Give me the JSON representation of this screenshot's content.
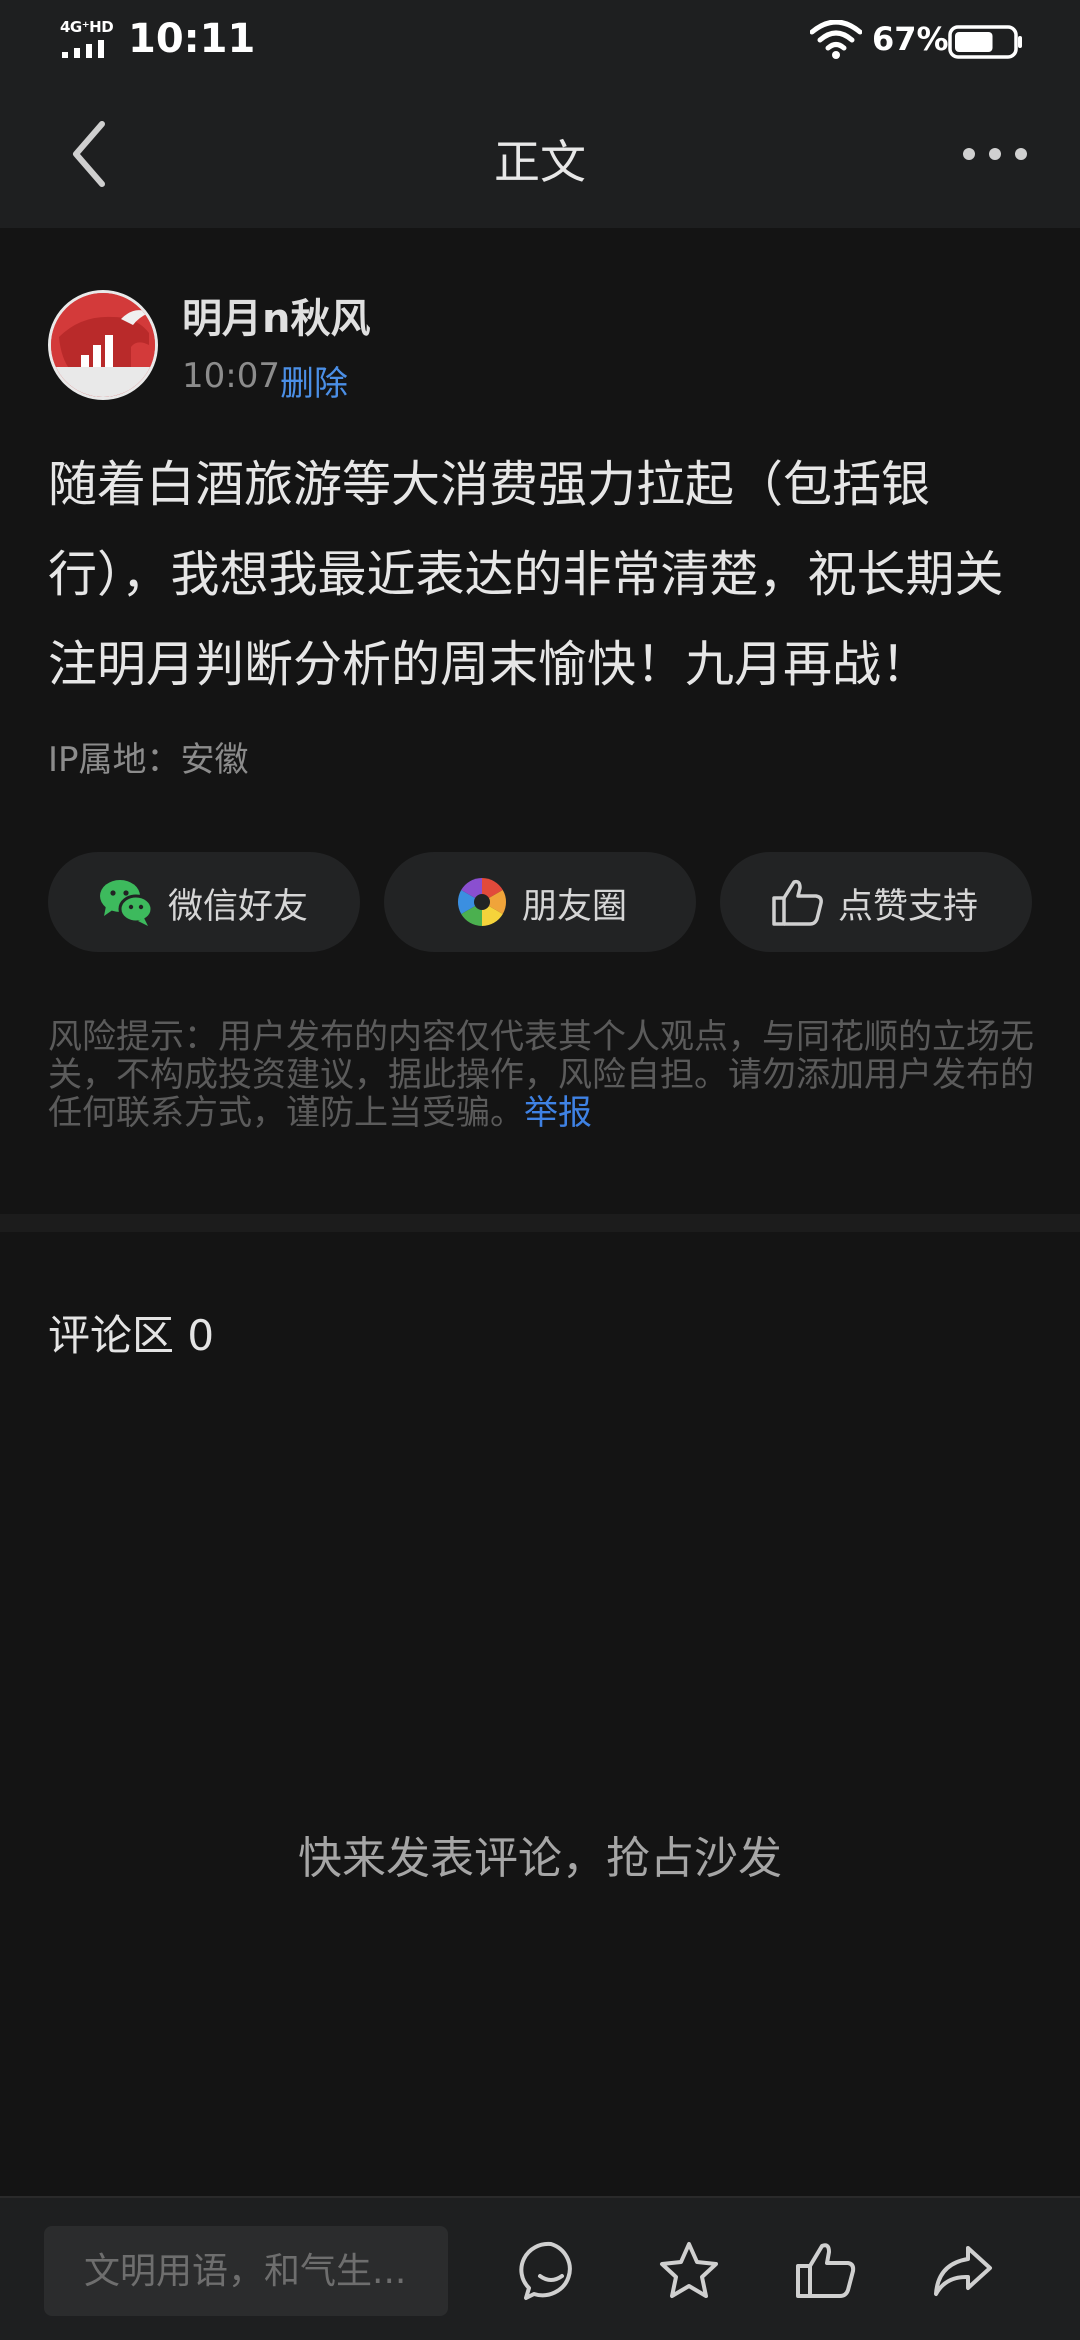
{
  "status_bar": {
    "network": "4G⁺HD",
    "time": "10:11",
    "battery_percent": "67%",
    "battery_level": 0.67
  },
  "nav": {
    "title": "正文"
  },
  "post": {
    "author": "明月n秋风",
    "time": "10:07",
    "delete_label": "删除",
    "content": "随着白酒旅游等大消费强力拉起（包括银行），我想我最近表达的非常清楚，祝长期关注明月判断分析的周末愉快！九月再战！",
    "ip_location": "IP属地：安徽"
  },
  "share_buttons": {
    "wechat": "微信好友",
    "moments": "朋友圈",
    "like": "点赞支持"
  },
  "risk_notice": {
    "text": "风险提示：用户发布的内容仅代表其个人观点，与同花顺的立场无关，不构成投资建议，据此操作，风险自担。请勿添加用户发布的任何联系方式，谨防上当受骗。",
    "report_label": "举报"
  },
  "comments": {
    "title": "评论区 0",
    "empty_hint": "快来发表评论，抢占沙发"
  },
  "bottom_bar": {
    "input_placeholder": "文明用语，和气生..."
  },
  "colors": {
    "background": "#141414",
    "bar_background": "#1e1f20",
    "link": "#4b8fe6",
    "wechat_green": "#3dba5d"
  }
}
